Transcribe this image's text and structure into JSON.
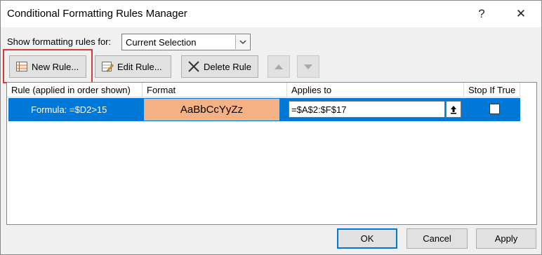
{
  "window": {
    "title": "Conditional Formatting Rules Manager",
    "help": "?",
    "close": "✕"
  },
  "filter": {
    "label": "Show formatting rules for:",
    "value": "Current Selection"
  },
  "toolbar": {
    "new_rule": "New Rule...",
    "edit_rule": "Edit Rule...",
    "delete_rule": "Delete Rule"
  },
  "table": {
    "columns": [
      "Rule (applied in order shown)",
      "Format",
      "Applies to",
      "Stop If True"
    ],
    "rows": [
      {
        "rule": "Formula: =$D2>15",
        "format_preview": "AaBbCcYyZz",
        "applies_to": "=$A$2:$F$17",
        "stop_if_true": false
      }
    ]
  },
  "buttons": {
    "ok": "OK",
    "cancel": "Cancel",
    "apply": "Apply"
  },
  "colors": {
    "selection": "#0078d7",
    "format_fill": "#f4b183",
    "highlight": "#d9373a"
  },
  "icons": {
    "new_rule": "new-rule-icon",
    "edit_rule": "edit-rule-icon",
    "delete_rule": "delete-x-icon",
    "move_up": "triangle-up-icon",
    "move_down": "triangle-down-icon",
    "collapse": "collapse-dialog-icon",
    "dropdown": "chevron-down-icon"
  }
}
